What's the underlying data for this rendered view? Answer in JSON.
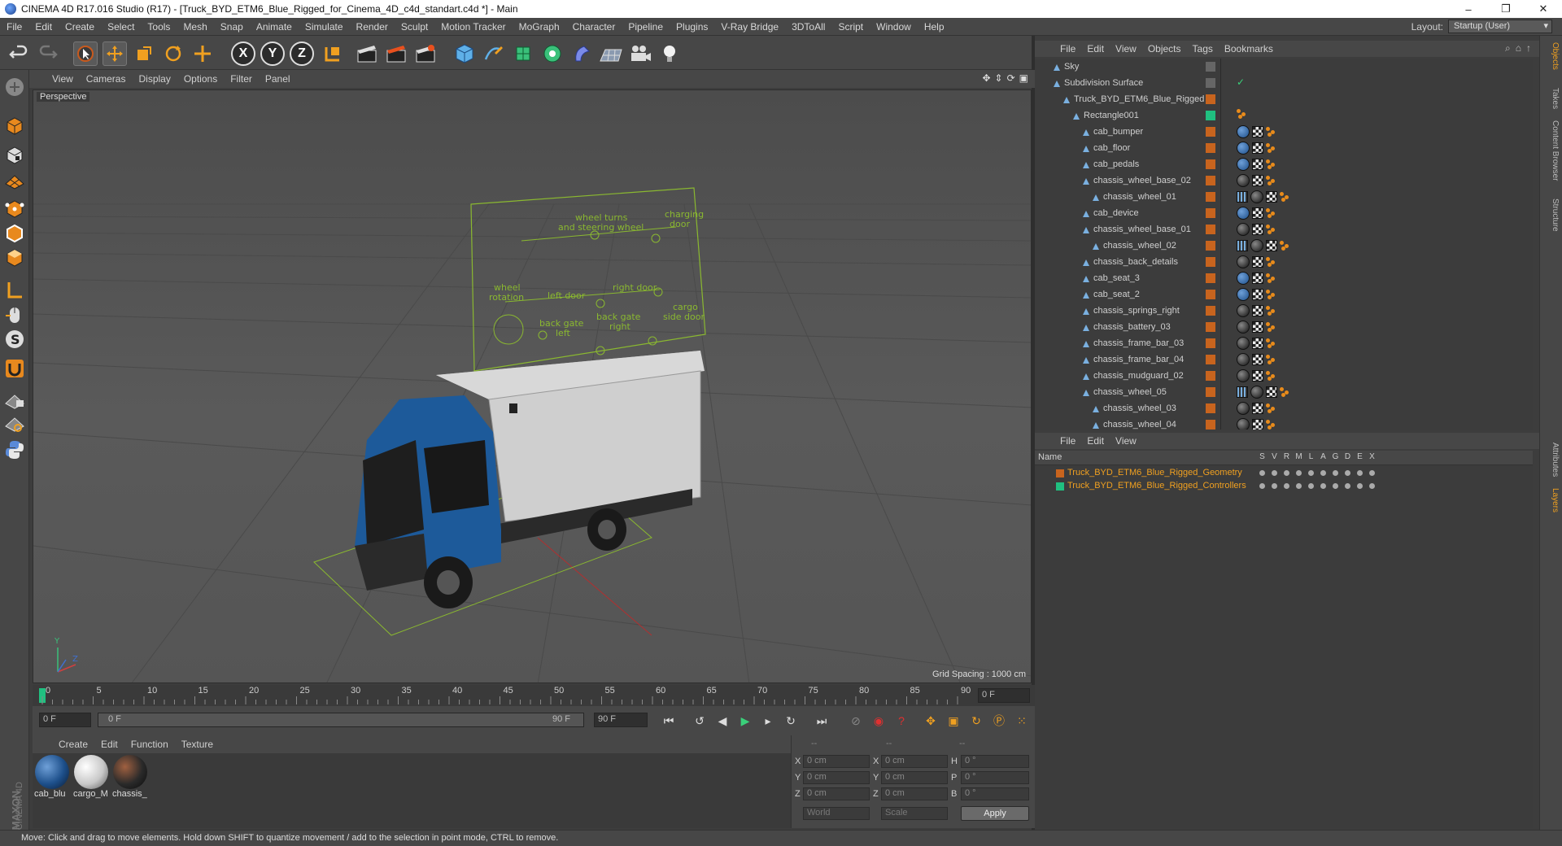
{
  "window": {
    "title": "CINEMA 4D R17.016 Studio (R17) - [Truck_BYD_ETM6_Blue_Rigged_for_Cinema_4D_c4d_standart.c4d *] - Main",
    "minimize": "–",
    "maximize": "❐",
    "close": "✕"
  },
  "menubar": {
    "items": [
      "File",
      "Edit",
      "Create",
      "Select",
      "Tools",
      "Mesh",
      "Snap",
      "Animate",
      "Simulate",
      "Render",
      "Sculpt",
      "Motion Tracker",
      "MoGraph",
      "Character",
      "Pipeline",
      "Plugins",
      "V-Ray Bridge",
      "3DToAll",
      "Script",
      "Window",
      "Help"
    ],
    "layout_label": "Layout:",
    "layout_value": "Startup (User)"
  },
  "toolbar": {
    "axis_x": "X",
    "axis_y": "Y",
    "axis_z": "Z"
  },
  "viewport": {
    "menu": [
      "View",
      "Cameras",
      "Display",
      "Options",
      "Filter",
      "Panel"
    ],
    "label": "Perspective",
    "grid_spacing": "Grid Spacing : 1000 cm",
    "hud_labels": {
      "wheel_turns": "wheel turns",
      "steering": "and steering wheel",
      "charging": "charging",
      "door": "door",
      "wheel": "wheel",
      "rotation": "rotation",
      "left_door": "left door",
      "right_door": "right door",
      "cargo": "cargo",
      "side_door": "side door",
      "back_gate_left_1": "back gate",
      "back_gate_left_2": "left",
      "back_gate_right_1": "back gate",
      "back_gate_right_2": "right"
    }
  },
  "timeline": {
    "ticks": [
      "0",
      "5",
      "10",
      "15",
      "20",
      "25",
      "30",
      "35",
      "40",
      "45",
      "50",
      "55",
      "60",
      "65",
      "70",
      "75",
      "80",
      "85",
      "90"
    ],
    "current_frame": "0 F",
    "start_field": "0 F",
    "range_start": "0 F",
    "range_end": "90 F",
    "end_field": "90 F"
  },
  "materials": {
    "menu": [
      "Create",
      "Edit",
      "Function",
      "Texture"
    ],
    "items": [
      {
        "name": "cab_blu",
        "color": "#1d4f8a"
      },
      {
        "name": "cargo_M",
        "color": "#c8c8c8"
      },
      {
        "name": "chassis_",
        "color": "#2a2a2a"
      }
    ]
  },
  "coordinates": {
    "headers": [
      "--",
      "--",
      "--"
    ],
    "rows": [
      {
        "a": "X",
        "av": "0 cm",
        "b": "X",
        "bv": "0 cm",
        "c": "H",
        "cv": "0 °"
      },
      {
        "a": "Y",
        "av": "0 cm",
        "b": "Y",
        "bv": "0 cm",
        "c": "P",
        "cv": "0 °"
      },
      {
        "a": "Z",
        "av": "0 cm",
        "b": "Z",
        "bv": "0 cm",
        "c": "B",
        "cv": "0 °"
      }
    ],
    "world": "World",
    "scale": "Scale",
    "apply": "Apply"
  },
  "status": "Move: Click and drag to move elements. Hold down SHIFT to quantize movement / add to the selection in point mode, CTRL to remove.",
  "objects": {
    "menu": [
      "File",
      "Edit",
      "View",
      "Objects",
      "Tags",
      "Bookmarks"
    ],
    "rows": [
      {
        "name": "Sky",
        "indent": 0,
        "color": "",
        "tags": []
      },
      {
        "name": "Subdivision Surface",
        "indent": 0,
        "color": "",
        "tags": [
          "check"
        ]
      },
      {
        "name": "Truck_BYD_ETM6_Blue_Rigged",
        "indent": 1,
        "color": "#c8641e",
        "tags": []
      },
      {
        "name": "Rectangle001",
        "indent": 2,
        "color": "#20c080",
        "tags": [
          "dots"
        ]
      },
      {
        "name": "cab_bumper",
        "indent": 3,
        "color": "#c8641e",
        "tags": [
          "blue",
          "chk",
          "dots"
        ]
      },
      {
        "name": "cab_floor",
        "indent": 3,
        "color": "#c8641e",
        "tags": [
          "blue",
          "chk",
          "dots"
        ]
      },
      {
        "name": "cab_pedals",
        "indent": 3,
        "color": "#c8641e",
        "tags": [
          "blue",
          "chk",
          "dots"
        ]
      },
      {
        "name": "chassis_wheel_base_02",
        "indent": 3,
        "color": "#c8641e",
        "tags": [
          "dark",
          "chk",
          "dots"
        ]
      },
      {
        "name": "chassis_wheel_01",
        "indent": 4,
        "color": "#c8641e",
        "tags": [
          "grid",
          "dark",
          "chk",
          "dots"
        ]
      },
      {
        "name": "cab_device",
        "indent": 3,
        "color": "#c8641e",
        "tags": [
          "blue",
          "chk",
          "dots"
        ]
      },
      {
        "name": "chassis_wheel_base_01",
        "indent": 3,
        "color": "#c8641e",
        "tags": [
          "dark",
          "chk",
          "dots"
        ]
      },
      {
        "name": "chassis_wheel_02",
        "indent": 4,
        "color": "#c8641e",
        "tags": [
          "grid",
          "dark",
          "chk",
          "dots"
        ]
      },
      {
        "name": "chassis_back_details",
        "indent": 3,
        "color": "#c8641e",
        "tags": [
          "dark",
          "chk",
          "dots"
        ]
      },
      {
        "name": "cab_seat_3",
        "indent": 3,
        "color": "#c8641e",
        "tags": [
          "blue",
          "chk",
          "dots"
        ]
      },
      {
        "name": "cab_seat_2",
        "indent": 3,
        "color": "#c8641e",
        "tags": [
          "blue",
          "chk",
          "dots"
        ]
      },
      {
        "name": "chassis_springs_right",
        "indent": 3,
        "color": "#c8641e",
        "tags": [
          "dark",
          "chk",
          "dots"
        ]
      },
      {
        "name": "chassis_battery_03",
        "indent": 3,
        "color": "#c8641e",
        "tags": [
          "dark",
          "chk",
          "dots"
        ]
      },
      {
        "name": "chassis_frame_bar_03",
        "indent": 3,
        "color": "#c8641e",
        "tags": [
          "dark",
          "chk",
          "dots"
        ]
      },
      {
        "name": "chassis_frame_bar_04",
        "indent": 3,
        "color": "#c8641e",
        "tags": [
          "dark",
          "chk",
          "dots"
        ]
      },
      {
        "name": "chassis_mudguard_02",
        "indent": 3,
        "color": "#c8641e",
        "tags": [
          "dark",
          "chk",
          "dots"
        ]
      },
      {
        "name": "chassis_wheel_05",
        "indent": 3,
        "color": "#c8641e",
        "tags": [
          "grid",
          "dark",
          "chk",
          "dots"
        ]
      },
      {
        "name": "chassis_wheel_03",
        "indent": 4,
        "color": "#c8641e",
        "tags": [
          "dark",
          "chk",
          "dots"
        ]
      },
      {
        "name": "chassis_wheel_04",
        "indent": 4,
        "color": "#c8641e",
        "tags": [
          "dark",
          "chk",
          "dots"
        ]
      }
    ]
  },
  "layers": {
    "menu": [
      "File",
      "Edit",
      "View"
    ],
    "header_name": "Name",
    "header_cols": [
      "S",
      "V",
      "R",
      "M",
      "L",
      "A",
      "G",
      "D",
      "E",
      "X"
    ],
    "rows": [
      {
        "name": "Truck_BYD_ETM6_Blue_Rigged_Geometry",
        "color": "#c8641e"
      },
      {
        "name": "Truck_BYD_ETM6_Blue_Rigged_Controllers",
        "color": "#20c080"
      }
    ]
  },
  "right_tabs": [
    "Objects",
    "Takes",
    "Content Browser",
    "Structure",
    "Attributes",
    "Layers"
  ],
  "brand": {
    "line1": "MAXON",
    "line2": "CINEMA 4D"
  }
}
